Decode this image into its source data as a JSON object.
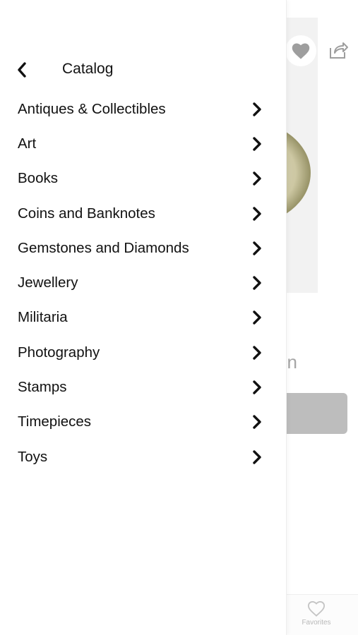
{
  "drawer": {
    "title": "Catalog",
    "back_icon": "chevron-left-icon",
    "items": [
      {
        "label": "Antiques & Collectibles",
        "icon": "chevron-right-icon"
      },
      {
        "label": "Art",
        "icon": "chevron-right-icon"
      },
      {
        "label": "Books",
        "icon": "chevron-right-icon"
      },
      {
        "label": "Coins and Banknotes",
        "icon": "chevron-right-icon"
      },
      {
        "label": "Gemstones and Diamonds",
        "icon": "chevron-right-icon"
      },
      {
        "label": "Jewellery",
        "icon": "chevron-right-icon"
      },
      {
        "label": "Militaria",
        "icon": "chevron-right-icon"
      },
      {
        "label": "Photography",
        "icon": "chevron-right-icon"
      },
      {
        "label": "Stamps",
        "icon": "chevron-right-icon"
      },
      {
        "label": "Timepieces",
        "icon": "chevron-right-icon"
      },
      {
        "label": "Toys",
        "icon": "chevron-right-icon"
      }
    ]
  },
  "background": {
    "title_fragment": "on",
    "favorite_icon": "heart-icon",
    "share_icon": "share-icon",
    "tabbar": {
      "favorites_label": "Favorites",
      "favorites_icon": "heart-outline-icon"
    }
  },
  "colors": {
    "drawer_bg": "#ffffff",
    "text": "#111111",
    "dimmed_text": "#a6a6a6",
    "dimmed_button": "#bdbdbd"
  }
}
